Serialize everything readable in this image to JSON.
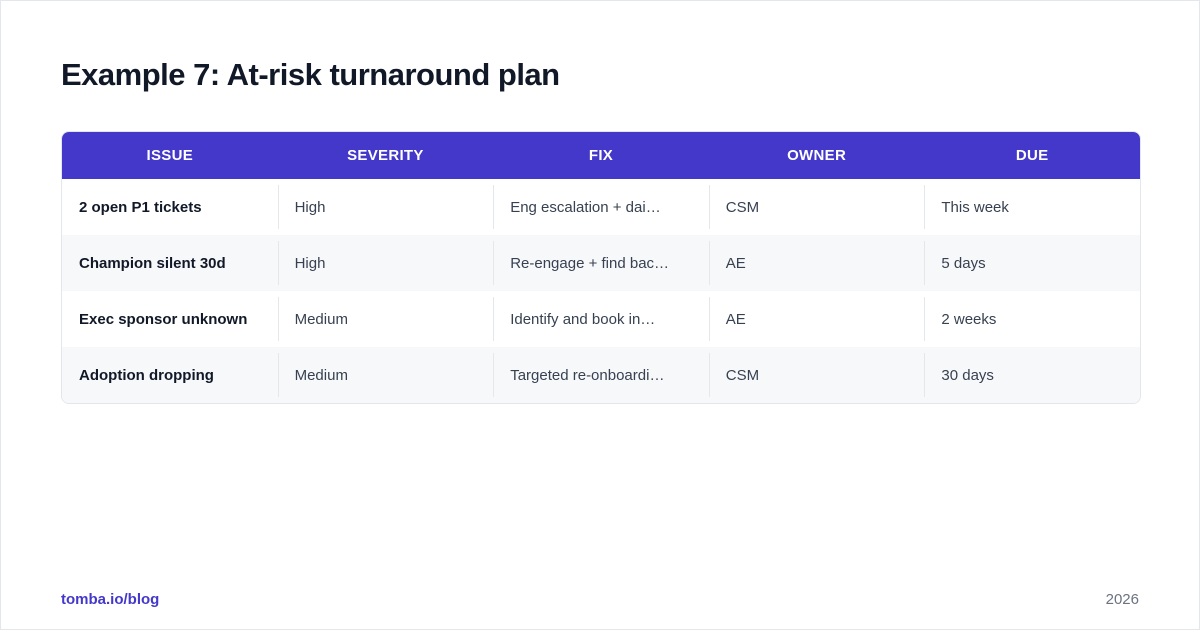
{
  "title": "Example 7: At-risk turnaround plan",
  "table": {
    "headers": [
      "ISSUE",
      "SEVERITY",
      "FIX",
      "OWNER",
      "DUE"
    ],
    "rows": [
      [
        "2 open P1 tickets",
        "High",
        "Eng escalation + dai…",
        "CSM",
        "This week"
      ],
      [
        "Champion silent 30d",
        "High",
        "Re-engage + find bac…",
        "AE",
        "5 days"
      ],
      [
        "Exec sponsor unknown",
        "Medium",
        "Identify and book in…",
        "AE",
        "2 weeks"
      ],
      [
        "Adoption dropping",
        "Medium",
        "Targeted re-onboardi…",
        "CSM",
        "30 days"
      ]
    ]
  },
  "footer": {
    "link": "tomba.io/blog",
    "year": "2026"
  },
  "colors": {
    "accent": "#4338ca",
    "title": "#111827",
    "row_alt": "#f7f8fa"
  }
}
